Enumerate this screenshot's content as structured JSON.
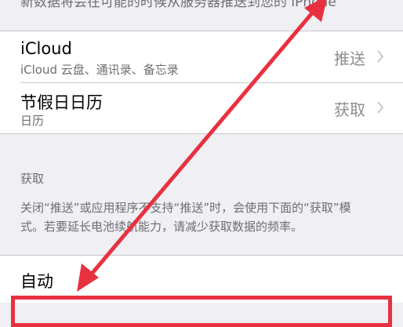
{
  "top_note": "新数据将会在可能的时候从服务器推送到您的 iPhone",
  "accounts": [
    {
      "title": "iCloud",
      "subtitle": "iCloud 云盘、通讯录、备忘录",
      "value": "推送"
    },
    {
      "title": "节假日日历",
      "subtitle": "日历",
      "value": "获取"
    }
  ],
  "fetch_group": {
    "header": "获取",
    "footer": "关闭“推送”或应用程序不支持“推送”时，会使用下面的“获取”模式。若要延长电池续航能力，请减少获取数据的频率。"
  },
  "auto_row": {
    "title": "自动"
  },
  "colors": {
    "annotation": "#e8313f",
    "background": "#efeff4",
    "secondary_text": "#6d6d72"
  },
  "icons": {
    "chevron": "chevron-right-icon",
    "arrow": "double-headed-arrow"
  }
}
